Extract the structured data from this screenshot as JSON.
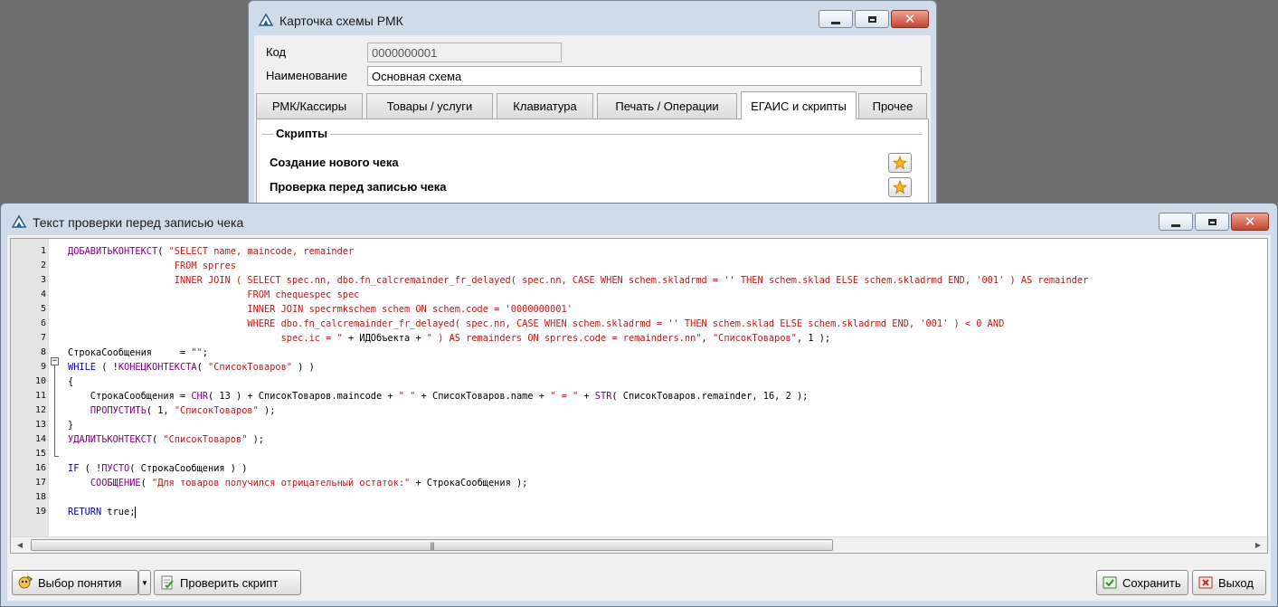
{
  "background_window": {
    "title": "Карточка схемы РМК",
    "code_label": "Код",
    "code_value": "0000000001",
    "name_label": "Наименование",
    "name_value": "Основная схема",
    "tabs": [
      {
        "label": "РМК/Кассиры",
        "active": false
      },
      {
        "label": "Товары / услуги",
        "active": false
      },
      {
        "label": "Клавиатура",
        "active": false
      },
      {
        "label": "Печать / Операции",
        "active": false
      },
      {
        "label": "ЕГАИС и скрипты",
        "active": true
      },
      {
        "label": "Прочее",
        "active": false
      }
    ],
    "scripts_group_title": "Скрипты",
    "script_items": [
      "Создание нового чека",
      "Проверка перед записью чека"
    ]
  },
  "editor_window": {
    "title": "Текст проверки перед записью чека",
    "line_numbers": [
      "1",
      "2",
      "3",
      "4",
      "5",
      "6",
      "7",
      "8",
      "9",
      "10",
      "11",
      "12",
      "13",
      "14",
      "15",
      "16",
      "17",
      "18",
      "19"
    ],
    "code_lines": [
      [
        {
          "t": "ДОБАВИТЬКОНТЕКСТ",
          "c": "cmd"
        },
        {
          "t": "( ",
          "c": "id"
        },
        {
          "t": "\"SELECT name, maincode, remainder",
          "c": "str"
        }
      ],
      [
        {
          "t": "                   FROM sprres",
          "c": "str"
        }
      ],
      [
        {
          "t": "                   INNER JOIN ( SELECT spec.nn, dbo.fn_calcremainder_fr_delayed( spec.nn, CASE WHEN schem.skladrmd = '' THEN schem.sklad ELSE schem.skladrmd END, '001' ) AS remainder",
          "c": "str"
        }
      ],
      [
        {
          "t": "                                FROM chequespec spec",
          "c": "str"
        }
      ],
      [
        {
          "t": "                                INNER JOIN specrmkschem schem ON schem.code = '0000000001'",
          "c": "str"
        }
      ],
      [
        {
          "t": "                                WHERE dbo.fn_calcremainder_fr_delayed( spec.nn, CASE WHEN schem.skladrmd = '' THEN schem.sklad ELSE schem.skladrmd END, '001' ) < 0 AND",
          "c": "str"
        }
      ],
      [
        {
          "t": "                                      spec.ic = \"",
          "c": "str"
        },
        {
          "t": " + ИДОбъекта + ",
          "c": "id"
        },
        {
          "t": "\" ) AS remainders ON sprres.code = remainders.nn\"",
          "c": "str"
        },
        {
          "t": ", ",
          "c": "id"
        },
        {
          "t": "\"СписокТоваров\"",
          "c": "str"
        },
        {
          "t": ", 1 );",
          "c": "id"
        }
      ],
      [
        {
          "t": "СтрокаСообщения     = ",
          "c": "id"
        },
        {
          "t": "\"\"",
          "c": "str"
        },
        {
          "t": ";",
          "c": "id"
        }
      ],
      [
        {
          "t": "WHILE",
          "c": "kw"
        },
        {
          "t": " ( !",
          "c": "id"
        },
        {
          "t": "КОНЕЦКОНТЕКСТА",
          "c": "cmd"
        },
        {
          "t": "( ",
          "c": "id"
        },
        {
          "t": "\"СписокТоваров\"",
          "c": "str"
        },
        {
          "t": " ) )",
          "c": "id"
        }
      ],
      [
        {
          "t": "{",
          "c": "id"
        }
      ],
      [
        {
          "t": "    СтрокаСообщения = ",
          "c": "id"
        },
        {
          "t": "CHR",
          "c": "cmd"
        },
        {
          "t": "( 13 ) + СписокТоваров.maincode + ",
          "c": "id"
        },
        {
          "t": "\" \"",
          "c": "str"
        },
        {
          "t": " + СписокТоваров.name + ",
          "c": "id"
        },
        {
          "t": "\" = \"",
          "c": "str"
        },
        {
          "t": " + ",
          "c": "id"
        },
        {
          "t": "STR",
          "c": "cmd"
        },
        {
          "t": "( СписокТоваров.remainder, 16, 2 );",
          "c": "id"
        }
      ],
      [
        {
          "t": "    ",
          "c": "id"
        },
        {
          "t": "ПРОПУСТИТЬ",
          "c": "cmd"
        },
        {
          "t": "( 1, ",
          "c": "id"
        },
        {
          "t": "\"СписокТоваров\"",
          "c": "str"
        },
        {
          "t": " );",
          "c": "id"
        }
      ],
      [
        {
          "t": "}",
          "c": "id"
        }
      ],
      [
        {
          "t": "УДАЛИТЬКОНТЕКСТ",
          "c": "cmd"
        },
        {
          "t": "( ",
          "c": "id"
        },
        {
          "t": "\"СписокТоваров\"",
          "c": "str"
        },
        {
          "t": " );",
          "c": "id"
        }
      ],
      [],
      [
        {
          "t": "IF",
          "c": "kw"
        },
        {
          "t": " ( !",
          "c": "id"
        },
        {
          "t": "ПУСТО",
          "c": "cmd"
        },
        {
          "t": "( СтрокаСообщения ) )",
          "c": "id"
        }
      ],
      [
        {
          "t": "    ",
          "c": "id"
        },
        {
          "t": "СООБЩЕНИЕ",
          "c": "cmd"
        },
        {
          "t": "( ",
          "c": "id"
        },
        {
          "t": "\"Для товаров получился отрицательный остаток:\"",
          "c": "str"
        },
        {
          "t": " + СтрокаСообщения );",
          "c": "id"
        }
      ],
      [],
      [
        {
          "t": "RETURN",
          "c": "kw"
        },
        {
          "t": " true;",
          "c": "id"
        }
      ]
    ],
    "buttons": {
      "concept": "Выбор понятия",
      "check": "Проверить скрипт",
      "save": "Сохранить",
      "exit": "Выход"
    }
  }
}
